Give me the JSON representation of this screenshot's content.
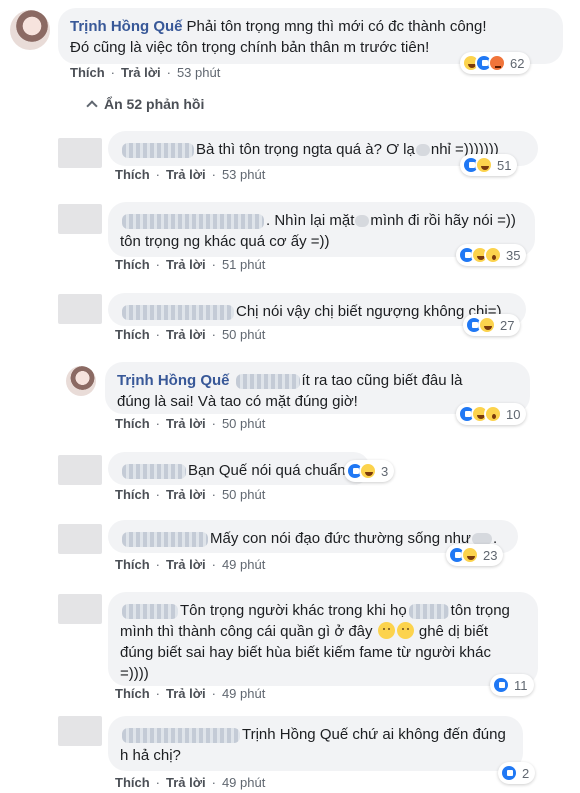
{
  "actions": {
    "like": "Thích",
    "reply": "Trả lời",
    "sep": "·"
  },
  "hide_replies": "Ẩn 52 phản hồi",
  "comments": [
    {
      "author": "Trịnh Hồng Quế",
      "text_a": "Phải tôn trọng mng thì mới có đc thành công!",
      "text_b": "Đó cũng là việc tôn trọng chính bản thân m trước tiên!",
      "time": "53 phút",
      "count": "62"
    },
    {
      "text_a": "Bà thì tôn trọng ngta quá à? Ơ lạ",
      "text_b": "nhỉ =)))))))",
      "time": "53 phút",
      "count": "51"
    },
    {
      "text_a": ". Nhìn lại mặt",
      "text_b": "mình đi rồi hãy nói =))",
      "text_c": "tôn trọng ng khác quá cơ ấy =))",
      "time": "51 phút",
      "count": "35"
    },
    {
      "text_a": "Chị nói vậy chị biết ngượng không chị=)",
      "time": "50 phút",
      "count": "27"
    },
    {
      "author": "Trịnh Hồng Quế",
      "text_a": "ít ra tao cũng biết đâu là",
      "text_b": "đúng là sai! Và tao có mặt đúng giờ!",
      "time": "50 phút",
      "count": "10"
    },
    {
      "text_a": "Bạn Quế nói quá chuẩn",
      "time": "50 phút",
      "count": "3"
    },
    {
      "text_a": "Mấy con nói đạo đức thường sống như",
      "text_b": ".",
      "time": "49 phút",
      "count": "23"
    },
    {
      "text_a": "Tôn trọng người khác trong khi họ",
      "text_b": "tôn trọng",
      "text_c": "mình thì thành công cái quần gì ở đây",
      "text_d": "ghê dị biết",
      "text_e": "đúng biết sai hay biết hùa biết kiếm fame từ người khác",
      "text_f": "=))))",
      "time": "49 phút",
      "count": "11"
    },
    {
      "text_a": "Trịnh Hồng Quế chứ ai không đến đúng",
      "text_b": "h hả chị?",
      "time": "49 phút",
      "count": "2"
    }
  ]
}
